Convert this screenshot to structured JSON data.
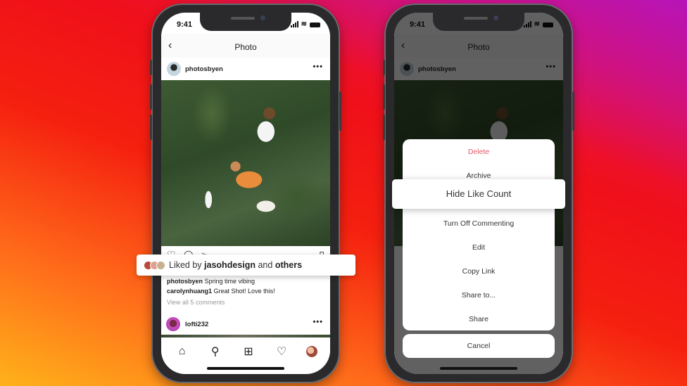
{
  "phones": {
    "left": {
      "status_time": "9:41",
      "nav_title": "Photo",
      "post_author": "photosbyen",
      "liked_by": {
        "prefix": "Liked by",
        "user": "jasohdesign",
        "middle": "and",
        "suffix": "others"
      },
      "captions": [
        {
          "user": "photosbyen",
          "text": "Spring time vibing"
        },
        {
          "user": "carolynhuang1",
          "text": "Great Shot! Love this!"
        }
      ],
      "view_all_comments": "View all 5 comments",
      "next_post_author": "lofti232",
      "icons": {
        "back": "‹",
        "more": "•••",
        "like": "♡",
        "comment": "◯",
        "share": "➢",
        "save": "▯",
        "home": "⌂",
        "search": "⚲",
        "add": "⊞",
        "activity": "♡"
      }
    },
    "right": {
      "status_time": "9:41",
      "nav_title": "Photo",
      "post_author": "photosbyen",
      "menu": {
        "delete": "Delete",
        "archive": "Archive",
        "hide_like_count": "Hide Like Count",
        "turn_off_commenting": "Turn Off Commenting",
        "edit": "Edit",
        "copy_link": "Copy Link",
        "share_to": "Share to...",
        "share": "Share",
        "cancel": "Cancel"
      },
      "colors": {
        "danger": "#e05a6a"
      }
    }
  }
}
